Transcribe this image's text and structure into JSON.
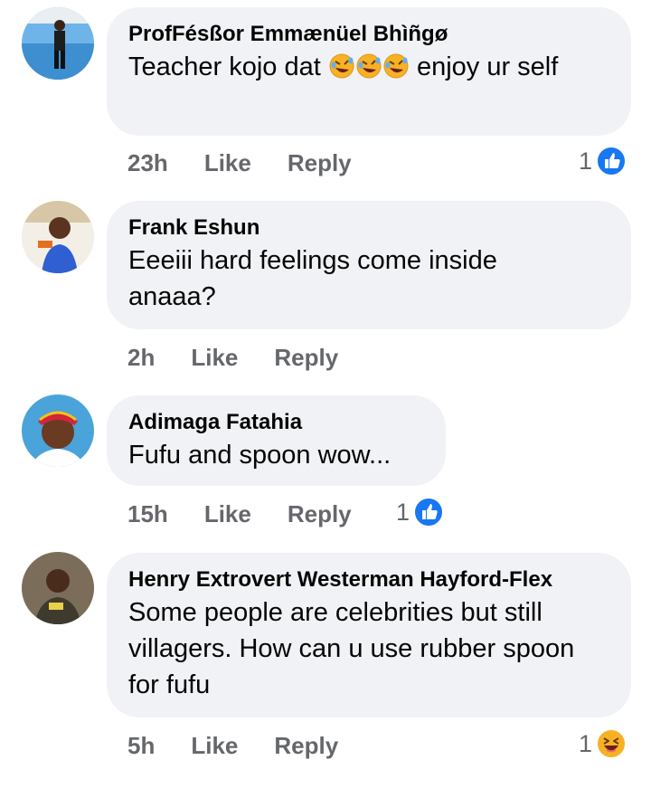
{
  "comments": [
    {
      "author": "ProfFésßor Emmænüel Bhìñgø",
      "text_before": "Teacher kojo dat",
      "text_after": "enjoy ur self",
      "emojis": [
        "rolling-on-floor-laughing",
        "rolling-on-floor-laughing",
        "rolling-on-floor-laughing"
      ],
      "time": "23h",
      "like_label": "Like",
      "reply_label": "Reply",
      "reaction_count": "1",
      "reaction_type": "like"
    },
    {
      "author": "Frank Eshun",
      "text": "Eeeiii hard feelings come inside anaaa?",
      "time": "2h",
      "like_label": "Like",
      "reply_label": "Reply"
    },
    {
      "author": "Adimaga Fatahia",
      "text": "Fufu and spoon wow...",
      "time": "15h",
      "like_label": "Like",
      "reply_label": "Reply",
      "reaction_count": "1",
      "reaction_type": "like"
    },
    {
      "author": "Henry Extrovert Westerman Hayford-Flex",
      "text": "Some people are celebrities but still villagers. How can u use rubber spoon for fufu",
      "time": "5h",
      "like_label": "Like",
      "reply_label": "Reply",
      "reaction_count": "1",
      "reaction_type": "haha"
    }
  ],
  "colors": {
    "bubble": "#f0f2f5",
    "meta_text": "#65676b",
    "like_blue": "#1877f2",
    "haha_yellow": "#f7b125"
  }
}
